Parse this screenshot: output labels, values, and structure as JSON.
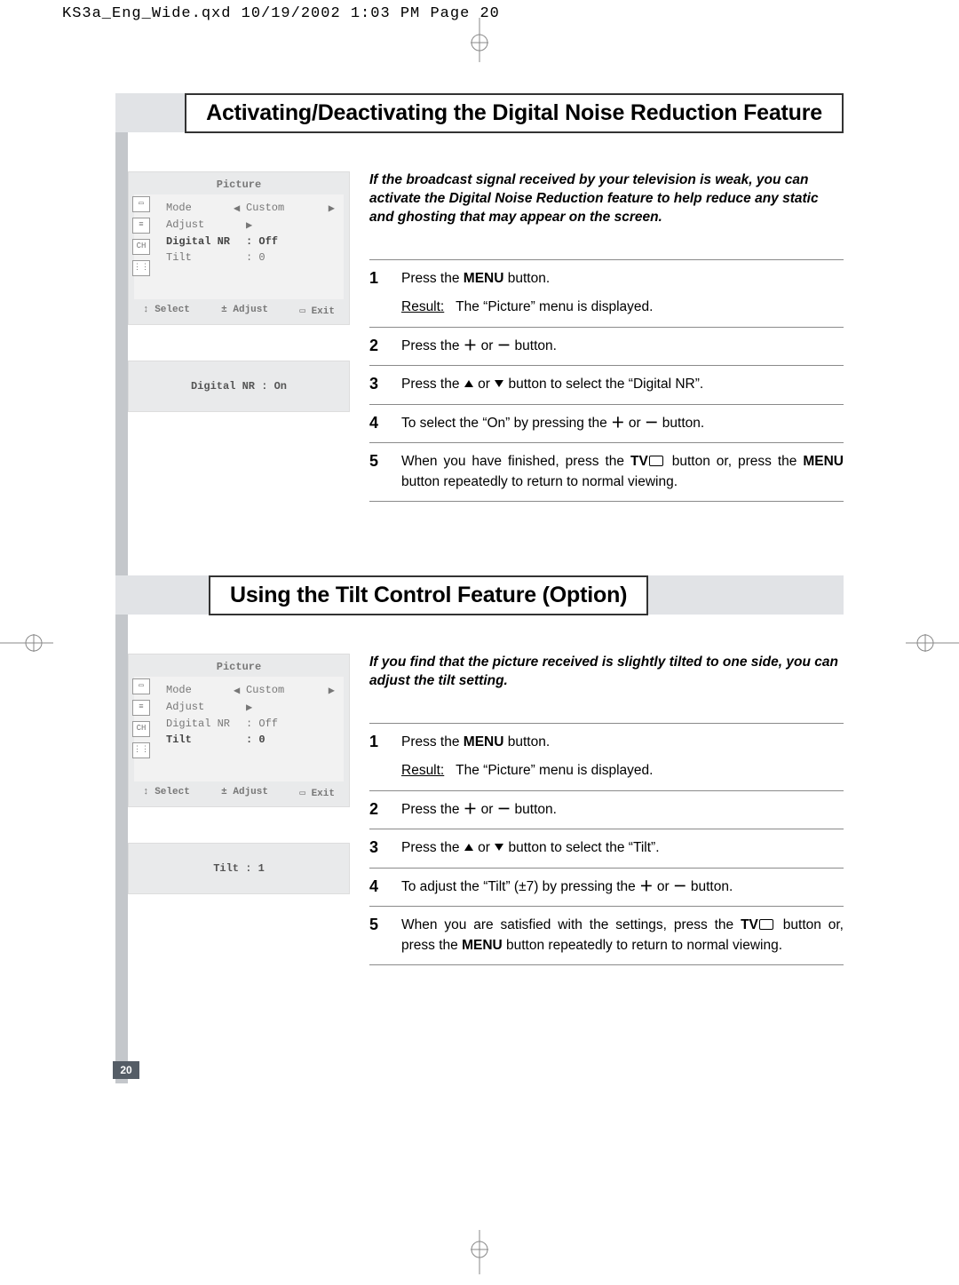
{
  "print_header": "KS3a_Eng_Wide.qxd  10/19/2002  1:03 PM  Page 20",
  "page_number": "20",
  "section1": {
    "title": "Activating/Deactivating the Digital Noise Reduction Feature",
    "osd": {
      "title": "Picture",
      "rows": [
        {
          "label": "Mode",
          "pre": "◀",
          "value": "Custom",
          "post": "▶",
          "bold": false
        },
        {
          "label": "Adjust",
          "pre": "",
          "value": "▶",
          "post": "",
          "bold": false
        },
        {
          "label": "Digital NR",
          "pre": "",
          "value": ": Off",
          "post": "",
          "bold": true
        },
        {
          "label": "Tilt",
          "pre": "",
          "value": ":  0",
          "post": "",
          "bold": false
        }
      ],
      "footer": {
        "select": "↕ Select",
        "adjust": "± Adjust",
        "exit": "▭ Exit"
      }
    },
    "osd_mini": "Digital NR : On",
    "intro": "If the broadcast signal received by your television is weak, you can activate the Digital Noise Reduction feature to help reduce any static and ghosting that may appear on the screen.",
    "steps": [
      {
        "n": "1",
        "kind": "menu_result"
      },
      {
        "n": "2",
        "kind": "plus_minus"
      },
      {
        "n": "3",
        "kind": "updown",
        "target": "Digital NR"
      },
      {
        "n": "4",
        "kind": "on_select"
      },
      {
        "n": "5",
        "kind": "finish_tv"
      }
    ]
  },
  "section2": {
    "title": "Using the Tilt Control Feature (Option)",
    "osd": {
      "title": "Picture",
      "rows": [
        {
          "label": "Mode",
          "pre": "◀",
          "value": "Custom",
          "post": "▶",
          "bold": false
        },
        {
          "label": "Adjust",
          "pre": "",
          "value": "▶",
          "post": "",
          "bold": false
        },
        {
          "label": "Digital NR",
          "pre": "",
          "value": ": Off",
          "post": "",
          "bold": false
        },
        {
          "label": "Tilt",
          "pre": "",
          "value": ":  0",
          "post": "",
          "bold": true
        }
      ],
      "footer": {
        "select": "↕ Select",
        "adjust": "± Adjust",
        "exit": "▭ Exit"
      }
    },
    "osd_mini": "Tilt : 1",
    "intro": "If you find that the picture received is slightly tilted to one side, you can adjust the tilt setting.",
    "steps": [
      {
        "n": "1",
        "kind": "menu_result"
      },
      {
        "n": "2",
        "kind": "plus_minus"
      },
      {
        "n": "3",
        "kind": "updown",
        "target": "Tilt"
      },
      {
        "n": "4",
        "kind": "tilt_adjust"
      },
      {
        "n": "5",
        "kind": "finish_tilt"
      }
    ]
  },
  "strings": {
    "press_the": "Press the ",
    "menu": "MENU",
    "button_period": " button.",
    "result": "Result:",
    "picture_displayed": "The “Picture” menu is displayed.",
    "plus": "＋",
    "minus": "－",
    "or": " or ",
    "button_to_select": " button to select the “",
    "quote_close_period": "”.",
    "to_select_on": "To select the “On” by pressing the ",
    "to_adjust_tilt": "To adjust the “Tilt” (±7) by pressing the ",
    "when_finished": "When you have finished, press the ",
    "tv": "TV",
    "button_or_press": " button or, press the ",
    "repeat_return": " button repeatedly to return to normal viewing.",
    "when_satisfied": "When you are satisfied with the settings, press the ",
    "button_or_press2": " button or, press the ",
    "menu2": "MENU"
  }
}
